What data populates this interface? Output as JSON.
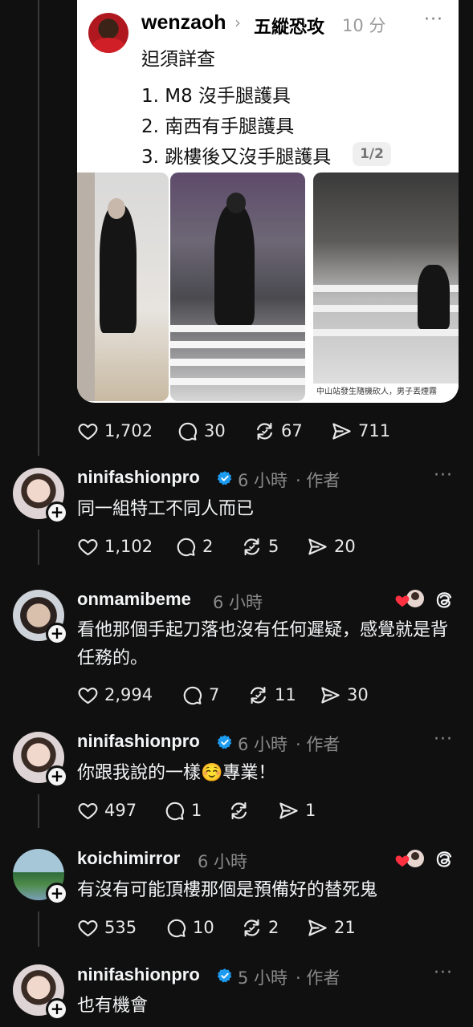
{
  "quoted_post": {
    "username": "wenzaoh",
    "topic": "五縱恐攻",
    "time": "10 分",
    "more": "···",
    "line1": "𨑨須詳查",
    "line2": "1. M8 沒手腿護具",
    "line3": "2. 南西有手腿護具",
    "line4": "3. 跳樓後又沒手腿護具",
    "image_counter": "1/2",
    "image_caption": "中山站發生隨機砍人，男子丟煙霧",
    "stats": {
      "likes": "1,702",
      "replies": "30",
      "reposts": "67",
      "shares": "711"
    }
  },
  "replies": [
    {
      "username": "ninifashionpro",
      "verified": true,
      "time": "6 小時",
      "author_tag": "· 作者",
      "text": "同一組特工不同人而已",
      "stats": {
        "likes": "1,102",
        "replies": "2",
        "reposts": "5",
        "shares": "20"
      }
    },
    {
      "username": "onmamibeme",
      "verified": false,
      "time": "6 小時",
      "text": "看他那個手起刀落也沒有任何遲疑，感覺就是背任務的。",
      "stats": {
        "likes": "2,994",
        "replies": "7",
        "reposts": "11",
        "shares": "30"
      }
    },
    {
      "username": "ninifashionpro",
      "verified": true,
      "time": "6 小時",
      "author_tag": "· 作者",
      "text": "你跟我說的一樣☺️專業！",
      "stats": {
        "likes": "497",
        "replies": "1",
        "reposts": "",
        "shares": "1"
      }
    },
    {
      "username": "koichimirror",
      "verified": false,
      "time": "6 小時",
      "text": "有沒有可能頂樓那個是預備好的替死鬼",
      "stats": {
        "likes": "535",
        "replies": "10",
        "reposts": "2",
        "shares": "21"
      }
    },
    {
      "username": "ninifashionpro",
      "verified": true,
      "time": "5 小時",
      "author_tag": "· 作者",
      "text": "也有機會"
    }
  ],
  "colors": {
    "background": "#101010",
    "verified": "#1d9bf0",
    "liked_heart": "#ff3040"
  },
  "icons": [
    "heart-icon",
    "comment-icon",
    "repost-icon",
    "share-icon",
    "verified-badge-icon",
    "threads-icon",
    "more-icon",
    "follow-plus-icon"
  ]
}
